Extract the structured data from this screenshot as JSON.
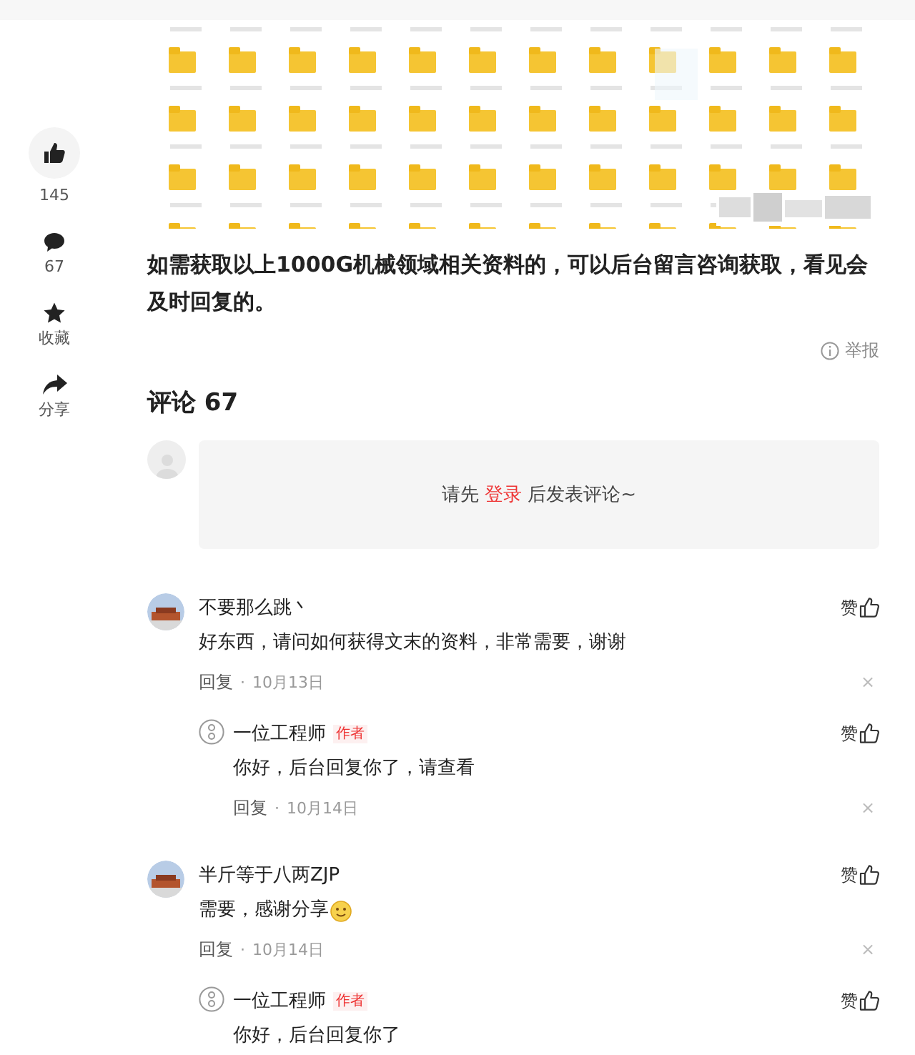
{
  "rail": [
    {
      "kind": "like",
      "label": "145"
    },
    {
      "kind": "comment",
      "label": "67"
    },
    {
      "kind": "star",
      "label": "收藏"
    },
    {
      "kind": "share",
      "label": "分享"
    }
  ],
  "article": {
    "paragraph": "如需获取以上1000G机械领域相关资料的，可以后台留言咨询获取，看见会及时回复的。",
    "report": "举报"
  },
  "comments_heading": "评论 67",
  "login_prompt": {
    "before": "请先",
    "link": "登录",
    "after": "后发表评论~"
  },
  "comments": [
    {
      "author": "不要那么跳丶",
      "text": "好东西，请问如何获得文末的资料，非常需要，谢谢",
      "emoji": false,
      "reply_label": "回复",
      "separator": "·",
      "date": "10月13日",
      "close": "×",
      "like_label": "赞",
      "replies": [
        {
          "author": "一位工程师",
          "badge": "作者",
          "text": "你好，后台回复你了，请查看",
          "reply_label": "回复",
          "separator": "·",
          "date": "10月14日",
          "close": "×",
          "like_label": "赞"
        }
      ]
    },
    {
      "author": "半斤等于八两ZJP",
      "text": "需要，感谢分享",
      "emoji": true,
      "reply_label": "回复",
      "separator": "·",
      "date": "10月14日",
      "close": "×",
      "like_label": "赞",
      "replies": [
        {
          "author": "一位工程师",
          "badge": "作者",
          "text": "你好，后台回复你了",
          "like_label": "赞"
        }
      ]
    }
  ]
}
